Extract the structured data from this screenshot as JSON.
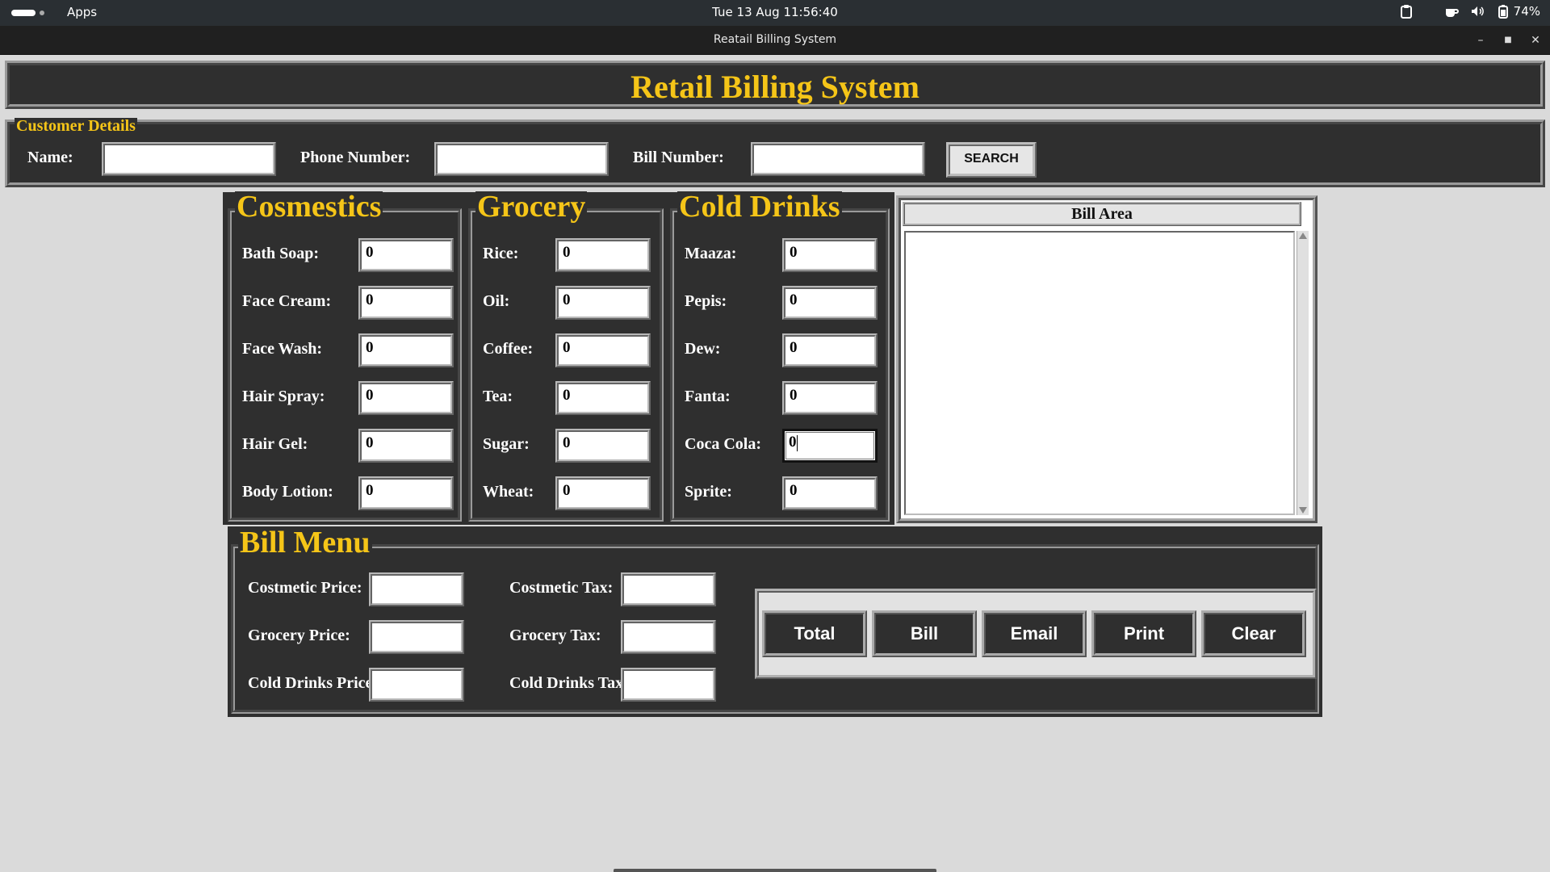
{
  "system_bar": {
    "apps_label": "Apps",
    "datetime": "Tue 13 Aug  11:56:40",
    "battery": "74%"
  },
  "window": {
    "title": "Reatail Billing System"
  },
  "header": {
    "title": "Retail Billing System"
  },
  "customer": {
    "legend": "Customer Details",
    "name_label": "Name:",
    "name_value": "",
    "phone_label": "Phone Number:",
    "phone_value": "",
    "bill_label": "Bill Number:",
    "bill_value": "",
    "search_label": "SEARCH"
  },
  "cosmetics": {
    "legend": "Cosmestics",
    "items": [
      {
        "label": "Bath Soap:",
        "value": "0"
      },
      {
        "label": "Face Cream:",
        "value": "0"
      },
      {
        "label": "Face Wash:",
        "value": "0"
      },
      {
        "label": "Hair Spray:",
        "value": "0"
      },
      {
        "label": "Hair Gel:",
        "value": "0"
      },
      {
        "label": "Body Lotion:",
        "value": "0"
      }
    ]
  },
  "grocery": {
    "legend": "Grocery",
    "items": [
      {
        "label": "Rice:",
        "value": "0"
      },
      {
        "label": "Oil:",
        "value": "0"
      },
      {
        "label": "Coffee:",
        "value": "0"
      },
      {
        "label": "Tea:",
        "value": "0"
      },
      {
        "label": "Sugar:",
        "value": "0"
      },
      {
        "label": "Wheat:",
        "value": "0"
      }
    ]
  },
  "cold_drinks": {
    "legend": "Cold Drinks",
    "items": [
      {
        "label": "Maaza:",
        "value": "0"
      },
      {
        "label": "Pepis:",
        "value": "0"
      },
      {
        "label": "Dew:",
        "value": "0"
      },
      {
        "label": "Fanta:",
        "value": "0"
      },
      {
        "label": "Coca Cola:",
        "value": "0"
      },
      {
        "label": "Sprite:",
        "value": "0"
      }
    ]
  },
  "bill_area": {
    "title": "Bill Area",
    "content": ""
  },
  "bill_menu": {
    "legend": "Bill Menu",
    "cosmetic_price_label": "Costmetic Price:",
    "cosmetic_price_value": "",
    "grocery_price_label": "Grocery Price:",
    "grocery_price_value": "",
    "cold_drinks_price_label": "Cold Drinks Price:",
    "cold_drinks_price_value": "",
    "cosmetic_tax_label": "Costmetic Tax:",
    "cosmetic_tax_value": "",
    "grocery_tax_label": "Grocery Tax:",
    "grocery_tax_value": "",
    "cold_drinks_tax_label": "Cold Drinks Tax:",
    "cold_drinks_tax_value": "",
    "buttons": {
      "total": "Total",
      "bill": "Bill",
      "email": "Email",
      "print": "Print",
      "clear": "Clear"
    }
  },
  "colors": {
    "panel_bg": "#2f2f2f",
    "accent_yellow": "#f5c518",
    "window_bg": "#dadada"
  }
}
